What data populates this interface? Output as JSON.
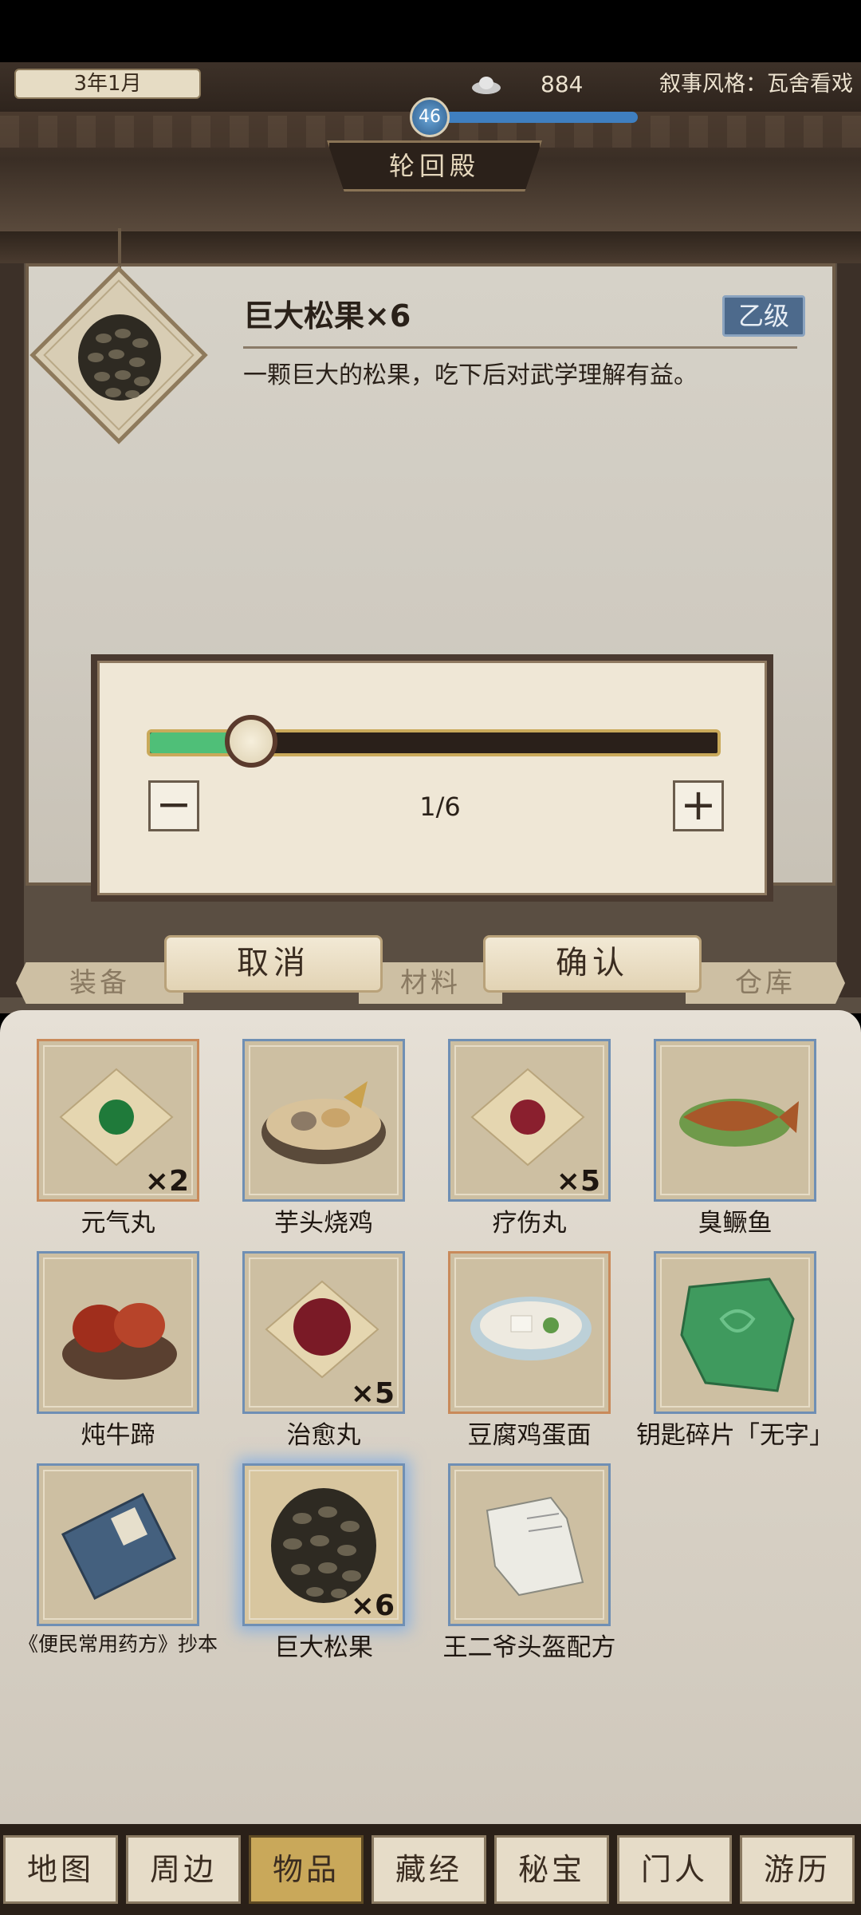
{
  "header": {
    "date": "3年1月",
    "currency": "884",
    "narrative_style": "叙事风格：瓦舍看戏",
    "level": "46",
    "hall_title": "轮回殿"
  },
  "item_detail": {
    "title": "巨大松果×6",
    "grade": "乙级",
    "description": "一颗巨大的松果，吃下后对武学理解有益。"
  },
  "quantity_dialog": {
    "minus_label": "−",
    "plus_label": "+",
    "quantity_text": "1/6",
    "slider_value": 1,
    "slider_max": 6
  },
  "actions": {
    "cancel_label": "取消",
    "confirm_label": "确认"
  },
  "tabs": {
    "equip": "装备",
    "material": "材料",
    "storage": "仓库"
  },
  "inventory": {
    "items": [
      {
        "name": "元气丸",
        "count": "×2",
        "icon": "green-pill-icon"
      },
      {
        "name": "芋头烧鸡",
        "count": "",
        "icon": "taro-chicken-bowl-icon"
      },
      {
        "name": "疗伤丸",
        "count": "×5",
        "icon": "red-pill-icon"
      },
      {
        "name": "臭鳜鱼",
        "count": "",
        "icon": "fish-dish-icon"
      },
      {
        "name": "炖牛蹄",
        "count": "",
        "icon": "beef-hoof-stew-icon"
      },
      {
        "name": "治愈丸",
        "count": "×5",
        "icon": "healing-pill-icon"
      },
      {
        "name": "豆腐鸡蛋面",
        "count": "",
        "icon": "noodle-bowl-icon"
      },
      {
        "name": "钥匙碎片「无字」",
        "count": "",
        "icon": "jade-key-fragment-icon"
      },
      {
        "name": "《便民常用药方》抄本",
        "count": "",
        "icon": "book-icon"
      },
      {
        "name": "巨大松果",
        "count": "×6",
        "icon": "pinecone-icon"
      },
      {
        "name": "王二爷头盔配方",
        "count": "",
        "icon": "paper-recipe-icon"
      }
    ]
  },
  "bottom_nav": {
    "items": [
      "地图",
      "周边",
      "物品",
      "藏经",
      "秘宝",
      "门人",
      "游历"
    ],
    "active": "物品"
  }
}
